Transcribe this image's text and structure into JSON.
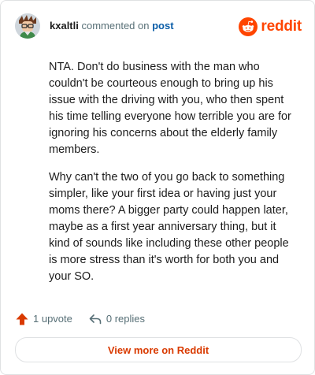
{
  "header": {
    "username": "kxaltli",
    "action_text": "commented on",
    "post_link": "post",
    "brand_name": "reddit",
    "brand_icon": "reddit-snoo-icon",
    "avatar": "user-avatar"
  },
  "comment": {
    "paragraphs": [
      "NTA. Don't do business with the man who couldn't be courteous enough to bring up his issue with the driving with you, who then spent his time telling everyone how terrible you are for ignoring his concerns about the elderly family members.",
      "Why can't the two of you go back to something simpler, like your first idea or having just your moms there? A bigger party could happen later, maybe as a first year anniversary thing, but it kind of sounds like including these other people is more stress than it's worth for both you and your SO."
    ]
  },
  "actions": {
    "upvotes": "1 upvote",
    "upvote_icon": "upvote-arrow-icon",
    "replies": "0 replies",
    "reply_icon": "reply-arrow-icon"
  },
  "footer": {
    "view_more": "View more on Reddit"
  },
  "colors": {
    "brand": "#ff4500",
    "upvote": "#d93a00",
    "link": "#0b5ea8",
    "text": "#1c1c1c",
    "muted": "#576f76",
    "border": "#dfe1e3"
  }
}
